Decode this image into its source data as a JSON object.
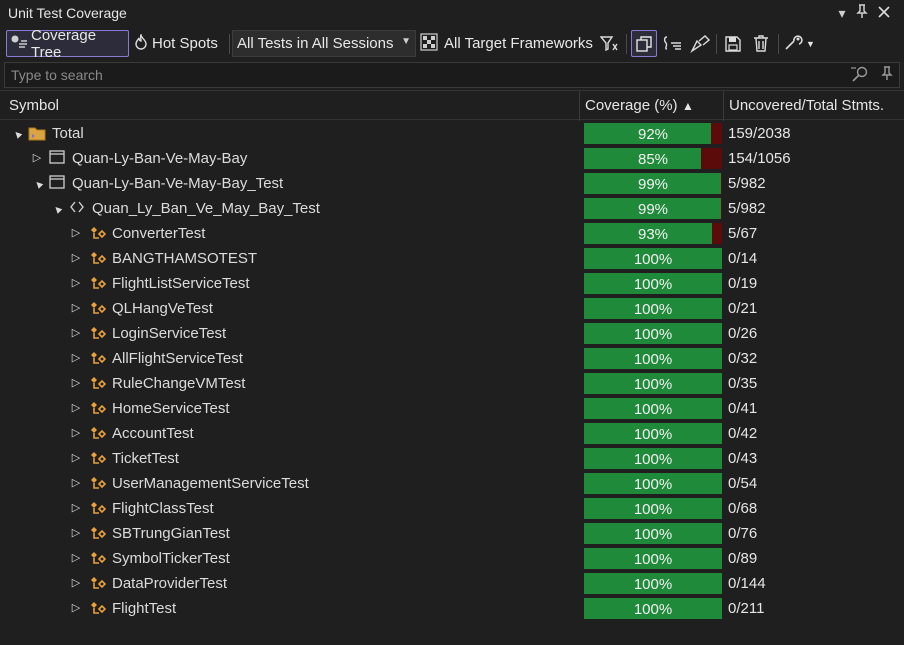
{
  "window": {
    "title": "Unit Test Coverage"
  },
  "toolbar": {
    "coverage_tree": "Coverage Tree",
    "hot_spots": "Hot Spots",
    "session_select": "All Tests in All Sessions",
    "frameworks": "All Target Frameworks"
  },
  "search": {
    "placeholder": "Type to search"
  },
  "columns": {
    "symbol": "Symbol",
    "coverage": "Coverage (%)",
    "sort_indicator": "▲",
    "uncovered": "Uncovered/Total Stmts."
  },
  "rows": [
    {
      "name": "Total",
      "kind": "solution",
      "toggle": "▲",
      "coverage": "92%",
      "fill": 0.92,
      "stmts": "159/2038"
    },
    {
      "name": "Quan-Ly-Ban-Ve-May-Bay",
      "kind": "project",
      "toggle": "▷",
      "coverage": "85%",
      "fill": 0.85,
      "stmts": "154/1056"
    },
    {
      "name": "Quan-Ly-Ban-Ve-May-Bay_Test",
      "kind": "project",
      "toggle": "▲",
      "coverage": "99%",
      "fill": 0.99,
      "stmts": "5/982"
    },
    {
      "name": "Quan_Ly_Ban_Ve_May_Bay_Test",
      "kind": "namespace",
      "toggle": "▲",
      "coverage": "99%",
      "fill": 0.99,
      "stmts": "5/982"
    },
    {
      "name": "ConverterTest",
      "kind": "class",
      "toggle": "▷",
      "coverage": "93%",
      "fill": 0.93,
      "stmts": "5/67"
    },
    {
      "name": "BANGTHAMSOTEST",
      "kind": "class",
      "toggle": "▷",
      "coverage": "100%",
      "fill": 1.0,
      "stmts": "0/14"
    },
    {
      "name": "FlightListServiceTest",
      "kind": "class",
      "toggle": "▷",
      "coverage": "100%",
      "fill": 1.0,
      "stmts": "0/19"
    },
    {
      "name": "QLHangVeTest",
      "kind": "class",
      "toggle": "▷",
      "coverage": "100%",
      "fill": 1.0,
      "stmts": "0/21"
    },
    {
      "name": "LoginServiceTest",
      "kind": "class",
      "toggle": "▷",
      "coverage": "100%",
      "fill": 1.0,
      "stmts": "0/26"
    },
    {
      "name": "AllFlightServiceTest",
      "kind": "class",
      "toggle": "▷",
      "coverage": "100%",
      "fill": 1.0,
      "stmts": "0/32"
    },
    {
      "name": "RuleChangeVMTest",
      "kind": "class",
      "toggle": "▷",
      "coverage": "100%",
      "fill": 1.0,
      "stmts": "0/35"
    },
    {
      "name": "HomeServiceTest",
      "kind": "class",
      "toggle": "▷",
      "coverage": "100%",
      "fill": 1.0,
      "stmts": "0/41"
    },
    {
      "name": "AccountTest",
      "kind": "class",
      "toggle": "▷",
      "coverage": "100%",
      "fill": 1.0,
      "stmts": "0/42"
    },
    {
      "name": "TicketTest",
      "kind": "class",
      "toggle": "▷",
      "coverage": "100%",
      "fill": 1.0,
      "stmts": "0/43"
    },
    {
      "name": "UserManagementServiceTest",
      "kind": "class",
      "toggle": "▷",
      "coverage": "100%",
      "fill": 1.0,
      "stmts": "0/54"
    },
    {
      "name": "FlightClassTest",
      "kind": "class",
      "toggle": "▷",
      "coverage": "100%",
      "fill": 1.0,
      "stmts": "0/68"
    },
    {
      "name": "SBTrungGianTest",
      "kind": "class",
      "toggle": "▷",
      "coverage": "100%",
      "fill": 1.0,
      "stmts": "0/76"
    },
    {
      "name": "SymbolTickerTest",
      "kind": "class",
      "toggle": "▷",
      "coverage": "100%",
      "fill": 1.0,
      "stmts": "0/89"
    },
    {
      "name": "DataProviderTest",
      "kind": "class",
      "toggle": "▷",
      "coverage": "100%",
      "fill": 1.0,
      "stmts": "0/144"
    },
    {
      "name": "FlightTest",
      "kind": "class",
      "toggle": "▷",
      "coverage": "100%",
      "fill": 1.0,
      "stmts": "0/211"
    }
  ],
  "colors": {
    "covered": "#1f8a3a",
    "uncovered": "#5c0b0b",
    "background": "#1f1f1f",
    "accent": "#8a7ad6",
    "class_icon": "#e8a13c"
  }
}
